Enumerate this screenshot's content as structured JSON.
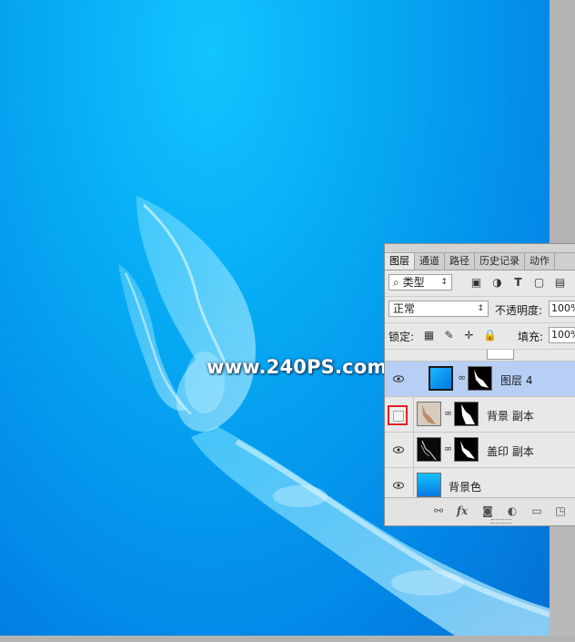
{
  "watermark": "www.240PS.com",
  "panel": {
    "tabs": [
      "图层",
      "通道",
      "路径",
      "历史记录",
      "动作"
    ],
    "filter": {
      "label": "类型"
    },
    "blend": {
      "mode": "正常",
      "opacity_label": "不透明度:",
      "opacity_value": "100%"
    },
    "lock": {
      "label": "锁定:",
      "fill_label": "填充:",
      "fill_value": "100%"
    },
    "layers": [
      {
        "name": "图层 4",
        "visible": true,
        "selected": true
      },
      {
        "name": "背景 副本",
        "visible": false,
        "selected": false
      },
      {
        "name": "盖印 副本",
        "visible": true,
        "selected": false
      },
      {
        "name": "背景色",
        "visible": true,
        "selected": false
      }
    ],
    "footer_icons": [
      "link-icon",
      "fx-icon",
      "mask-icon",
      "adjustment-icon",
      "folder-icon",
      "new-layer-icon"
    ]
  },
  "colors": {
    "canvas_light": "#12c4ff",
    "canvas_dark": "#056fd4",
    "selected_layer": "#b7cff5",
    "highlight_box": "#e02020"
  }
}
